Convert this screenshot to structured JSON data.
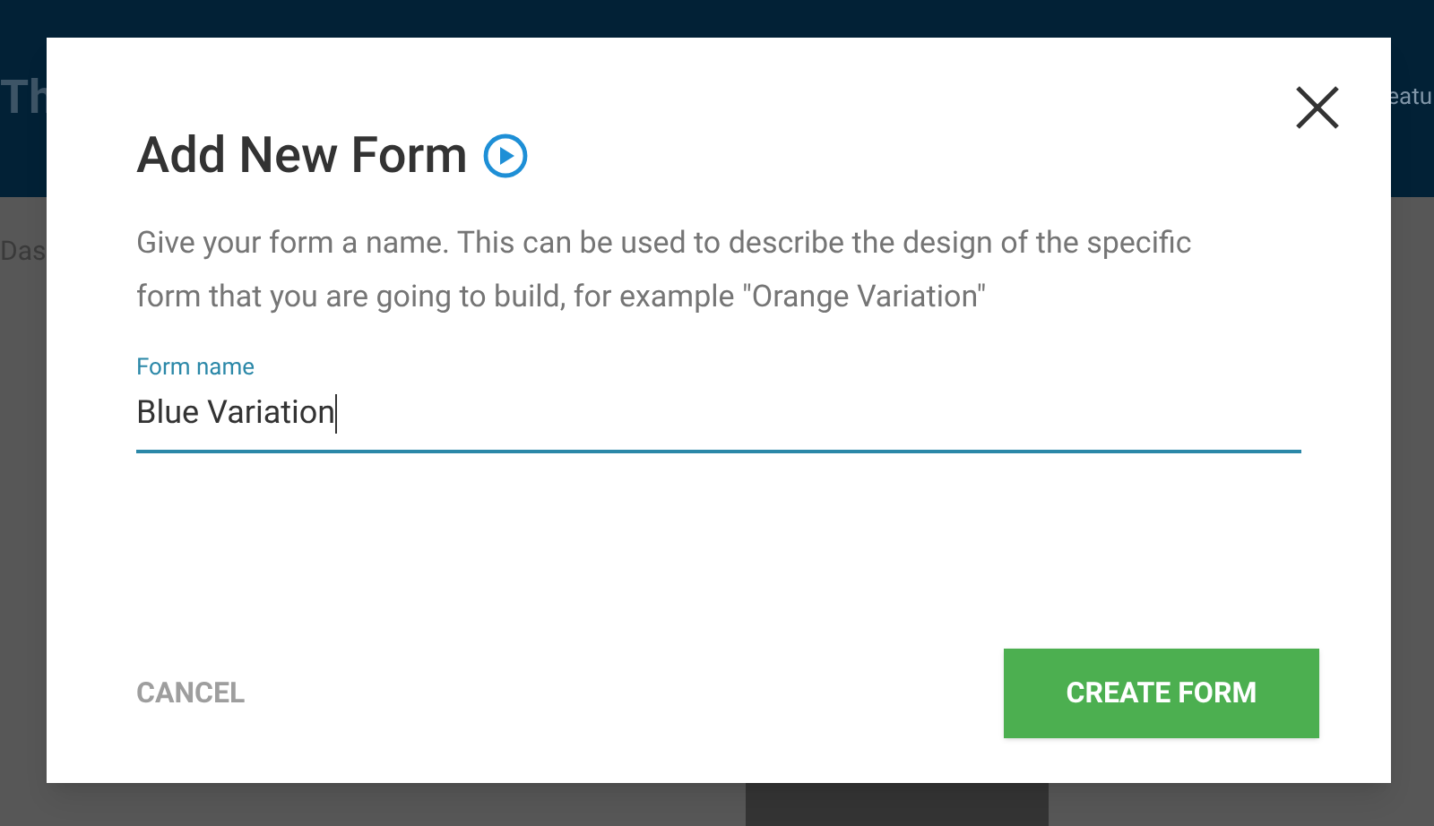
{
  "background": {
    "header_title": "Th",
    "header_link": "eatu",
    "breadcrumb": "Das"
  },
  "dialog": {
    "title": "Add New Form",
    "description": "Give your form a name. This can be used to describe the design of the specific form that you are going to build, for example \"Orange Variation\"",
    "field": {
      "label": "Form name",
      "value": "Blue Variation",
      "focused": true
    },
    "cancel": "CANCEL",
    "submit": "CREATE FORM"
  }
}
